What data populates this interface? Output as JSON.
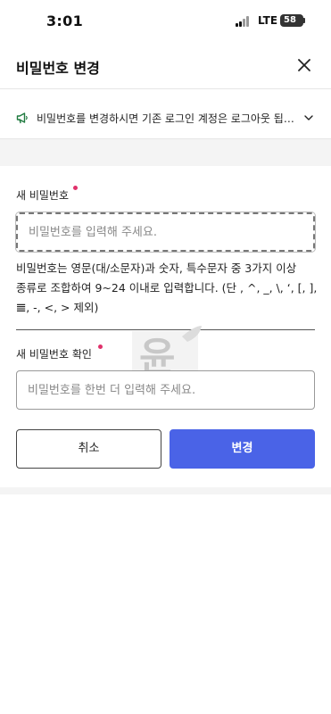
{
  "status_bar": {
    "time": "3:01",
    "network": "LTE",
    "battery": "58"
  },
  "header": {
    "title": "비밀번호 변경",
    "close_icon": "close-icon"
  },
  "notice": {
    "icon": "megaphone-icon",
    "text": "비밀번호를 변경하시면 기존 로그인 계정은 로그아웃 됩니다."
  },
  "form": {
    "new_password": {
      "label": "새 비밀번호",
      "placeholder": "비밀번호를 입력해 주세요."
    },
    "hint": "비밀번호는 영문(대/소문자)과 숫자, 특수문자 중 3가지 이상 종류로 조합하여 9~24 이내로 입력합니다. (단 , ^, _, \\, ‘, [, ], 𝌆, -, <, > 제외)",
    "confirm_password": {
      "label": "새 비밀번호 확인",
      "placeholder": "비밀번호를 한번 더 입력해 주세요."
    },
    "cancel_label": "취소",
    "submit_label": "변경"
  },
  "watermark": {
    "text": "윤"
  },
  "colors": {
    "accent": "#4a63e7",
    "required_dot": "#e0316b",
    "notice_icon": "#1f7a3f"
  }
}
